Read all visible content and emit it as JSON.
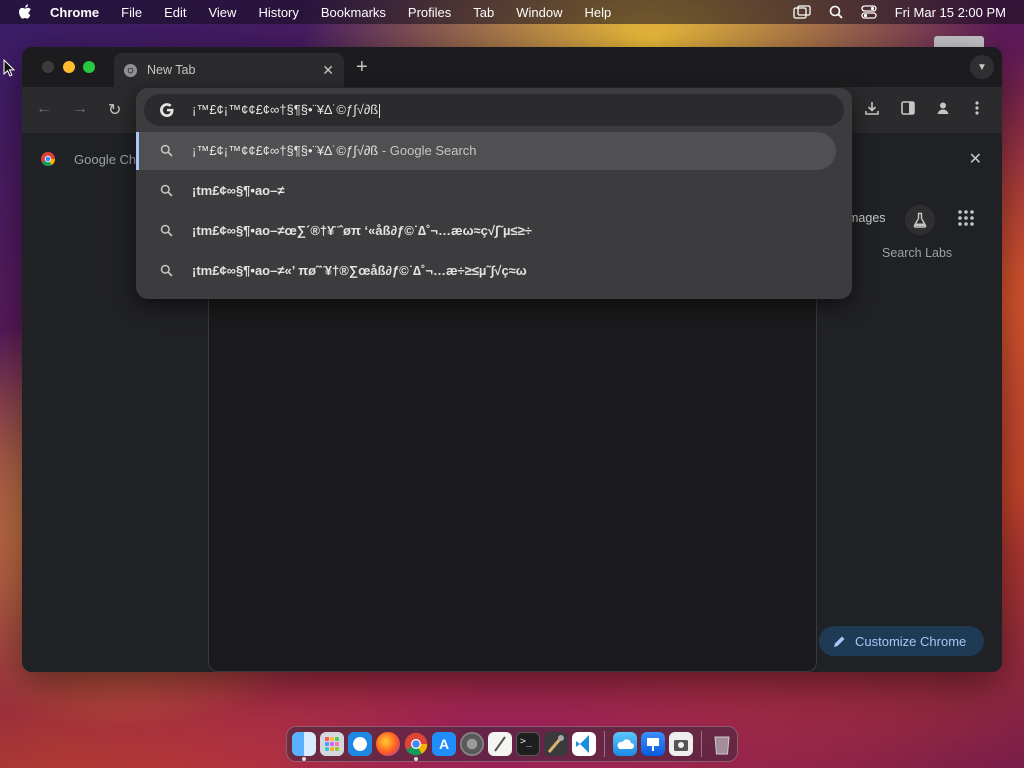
{
  "menubar": {
    "app_name": "Chrome",
    "items": [
      "File",
      "Edit",
      "View",
      "History",
      "Bookmarks",
      "Profiles",
      "Tab",
      "Window",
      "Help"
    ],
    "datetime": "Fri Mar 15  2:00 PM"
  },
  "tab": {
    "title": "New Tab"
  },
  "omnibox": {
    "input_value": "¡™£¢¡™¢¢£¢∞†§¶§•¨¥∆˙©ƒ∫√∂ß",
    "suggestions": [
      {
        "text": "¡™£¢¡™¢¢£¢∞†§¶§•¨¥∆˙©ƒ∫√∂ß",
        "suffix": " - Google Search",
        "selected": true
      },
      {
        "text": "¡tm£¢∞§¶•ao–≠",
        "suffix": "",
        "selected": false
      },
      {
        "text": "¡tm£¢∞§¶•ao–≠œ∑´®†¥¨ˆøπ ‘«åß∂ƒ©˙∆˚¬…æω≈ç√∫˜µ≤≥÷",
        "suffix": "",
        "selected": false
      },
      {
        "text": "¡tm£¢∞§¶•ao–≠«’ πø˜¨¥†®∑œåß∂ƒ©˙∆˚¬…æ÷≥≤µ˜∫√ç≈ω",
        "suffix": "",
        "selected": false
      }
    ]
  },
  "bookmarks": {
    "item_label": "Google Ch"
  },
  "newtab": {
    "images_link": "mages",
    "search_labs_label": "Search Labs",
    "customize_label": "Customize Chrome"
  },
  "colors": {
    "accent": "#a8c7fa",
    "window_bg": "#202124",
    "omnibox_bg": "#3c3c3e"
  },
  "icons": {
    "menubar_right": [
      "screen-mirror-icon",
      "search-icon",
      "control-center-icon"
    ],
    "dock": [
      "finder-icon",
      "launchpad-icon",
      "safari-icon",
      "firefox-icon",
      "chrome-icon",
      "app-store-icon",
      "system-settings-icon",
      "textedit-icon",
      "terminal-icon",
      "instruments-icon",
      "vscode-icon",
      "icloud-icon",
      "keynote-icon",
      "preview-icon",
      "trash-icon"
    ]
  }
}
